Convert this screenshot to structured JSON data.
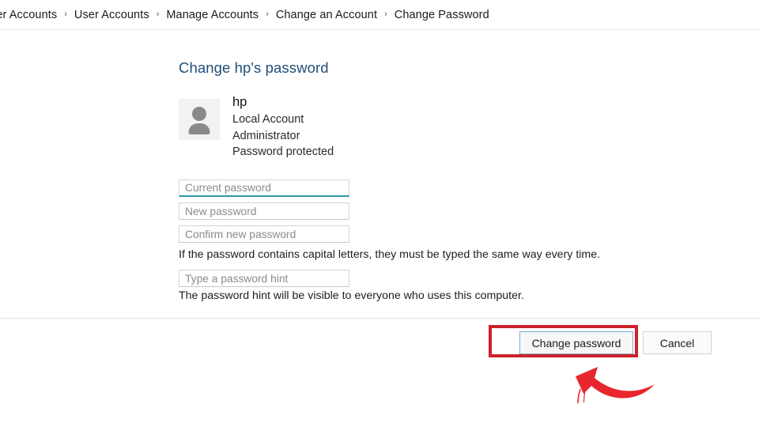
{
  "window": {
    "title": "Change Password",
    "background": "#ffffff"
  },
  "breadcrumb": {
    "name": "breadcrumb",
    "separator": "›",
    "items": [
      {
        "label": "ser Accounts"
      },
      {
        "label": "User Accounts"
      },
      {
        "label": "Manage Accounts"
      },
      {
        "label": "Change an Account"
      },
      {
        "label": "Change Password"
      }
    ]
  },
  "main": {
    "page_title": "Change hp's password",
    "title_color": "#1f4e79",
    "account": {
      "avatar_icon": "user-avatar-icon",
      "name": "hp",
      "account_type": "Local Account",
      "role": "Administrator",
      "password_status": "Password protected"
    },
    "fields": [
      {
        "id": "current",
        "name": "current-password-input",
        "placeholder": "Current password",
        "value": "",
        "focused": true,
        "accent": "#2f95a8"
      },
      {
        "id": "new",
        "name": "new-password-input",
        "placeholder": "New password",
        "value": "",
        "focused": false,
        "accent": "#c8c8c8"
      },
      {
        "id": "confirm",
        "name": "confirm-password-input",
        "placeholder": "Confirm new password",
        "value": "",
        "focused": false,
        "accent": "#c8c8c8"
      },
      {
        "id": "hint",
        "name": "password-hint-input",
        "placeholder": "Type a password hint",
        "value": "",
        "focused": false,
        "accent": "#c8c8c8"
      }
    ],
    "helper_caps": "If the password contains capital letters, they must be typed the same way every time.",
    "helper_hint": "The password hint will be visible to everyone who uses this computer."
  },
  "footer": {
    "change_password_label": "Change password",
    "cancel_label": "Cancel"
  },
  "annotations": {
    "highlight_color": "#cc2229",
    "arrow_color": "#e8262d",
    "highlight_target": "change-password-button",
    "arrow_icon": "curved-arrow-icon"
  }
}
